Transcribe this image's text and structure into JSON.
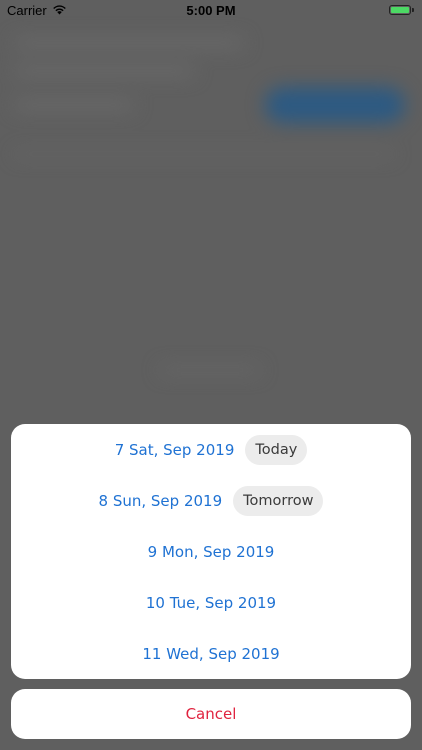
{
  "status_bar": {
    "carrier": "Carrier",
    "time": "5:00 PM",
    "battery_level": 1.0,
    "battery_color": "#4cd964"
  },
  "sheet": {
    "options": [
      {
        "label": "7 Sat, Sep 2019",
        "badge": "Today"
      },
      {
        "label": "8 Sun, Sep 2019",
        "badge": "Tomorrow"
      },
      {
        "label": "9 Mon, Sep 2019"
      },
      {
        "label": "10 Tue, Sep 2019"
      },
      {
        "label": "11 Wed, Sep 2019"
      }
    ],
    "cancel_label": "Cancel"
  },
  "colors": {
    "accent": "#1f72d3",
    "destructive": "#e0233f",
    "badge_bg": "#ececec",
    "overlay": "#5f5f5f"
  }
}
